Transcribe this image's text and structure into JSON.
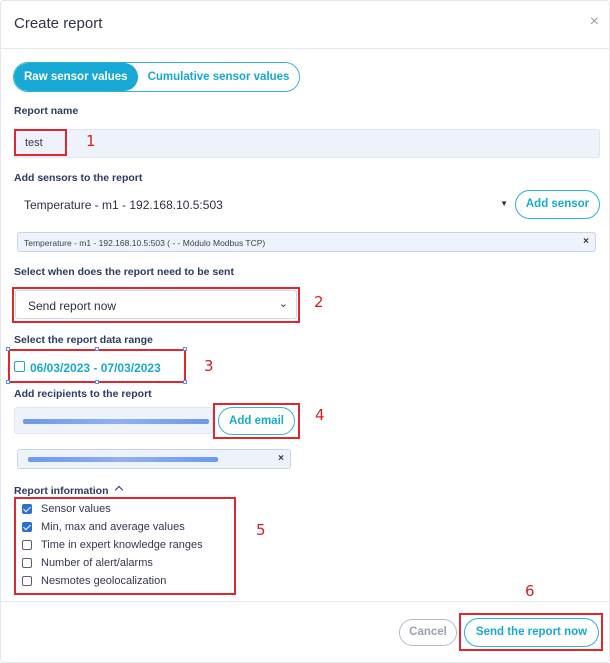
{
  "dialog": {
    "title": "Create report",
    "close_symbol": "×"
  },
  "tabs": {
    "raw": "Raw sensor values",
    "cumulative": "Cumulative sensor values"
  },
  "report_name": {
    "label": "Report name",
    "value": "test"
  },
  "sensors": {
    "label": "Add sensors to the report",
    "selected": "Temperature - m1 - 192.168.10.5:503",
    "add_button": "Add sensor",
    "chip": "Temperature - m1 - 192.168.10.5:503 ( - - Módulo Modbus TCP)",
    "chip_remove": "×"
  },
  "send_when": {
    "label": "Select when does the report need to be sent",
    "selected": "Send report now"
  },
  "date_range": {
    "label": "Select the report data range",
    "value": "06/03/2023 - 07/03/2023"
  },
  "recipients": {
    "label": "Add recipients to the report",
    "add_button": "Add email",
    "chip_remove": "×"
  },
  "report_info": {
    "label": "Report information",
    "options": [
      {
        "label": "Sensor values",
        "checked": true
      },
      {
        "label": "Min, max and average values",
        "checked": true
      },
      {
        "label": "Time in expert knowledge ranges",
        "checked": false
      },
      {
        "label": "Number of alert/alarms",
        "checked": false
      },
      {
        "label": "Nesmotes geolocalization",
        "checked": false
      }
    ]
  },
  "footer": {
    "cancel": "Cancel",
    "send": "Send the report now"
  },
  "annotations": [
    "1",
    "2",
    "3",
    "4",
    "5",
    "6"
  ],
  "colors": {
    "accent": "#17a9d4",
    "annotation_red": "#e0262e",
    "title_blue": "#2b3a67",
    "checkbox_blue": "#2c6fd6"
  }
}
